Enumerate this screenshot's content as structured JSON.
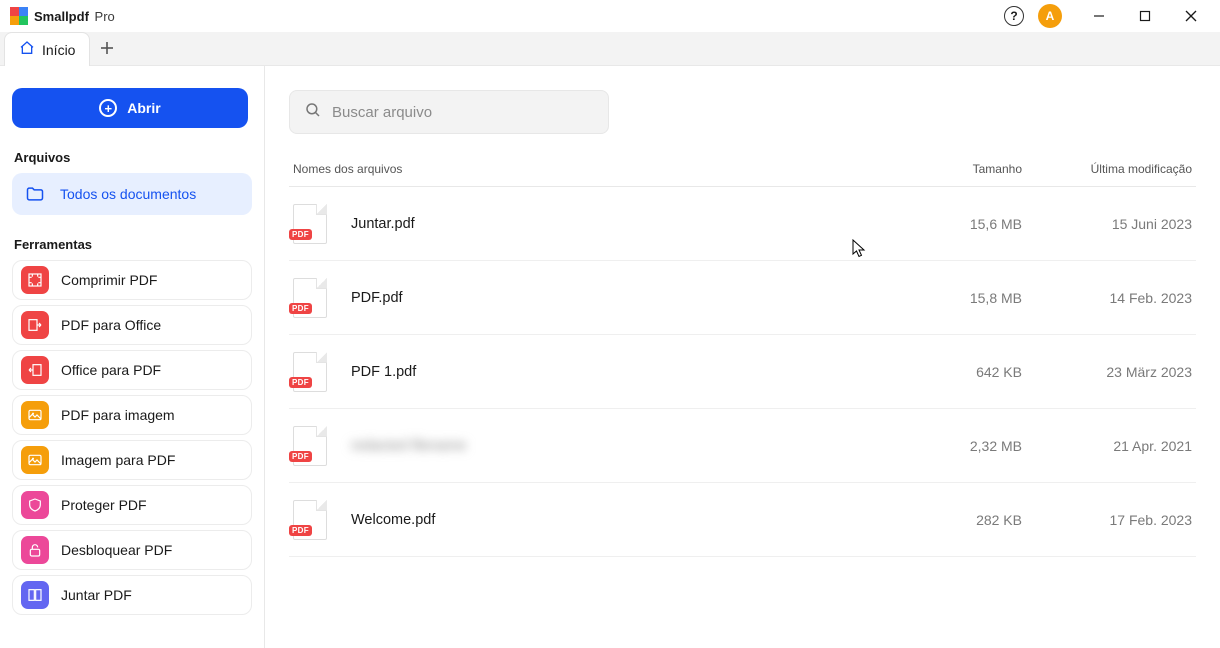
{
  "app": {
    "name": "Smallpdf",
    "tier": "Pro"
  },
  "avatar": {
    "initial": "A"
  },
  "tabs": {
    "home_label": "Início"
  },
  "sidebar": {
    "open_label": "Abrir",
    "section_files": "Arquivos",
    "all_docs": "Todos os documentos",
    "section_tools": "Ferramentas",
    "tools": [
      {
        "label": "Comprimir PDF",
        "color": "red",
        "icon": "compress"
      },
      {
        "label": "PDF para Office",
        "color": "red",
        "icon": "to-office"
      },
      {
        "label": "Office para PDF",
        "color": "red",
        "icon": "from-office"
      },
      {
        "label": "PDF para imagem",
        "color": "amber",
        "icon": "to-image"
      },
      {
        "label": "Imagem para PDF",
        "color": "amber",
        "icon": "from-image"
      },
      {
        "label": "Proteger PDF",
        "color": "pink",
        "icon": "protect"
      },
      {
        "label": "Desbloquear PDF",
        "color": "pink",
        "icon": "unlock"
      },
      {
        "label": "Juntar PDF",
        "color": "ind",
        "icon": "merge"
      }
    ]
  },
  "search": {
    "placeholder": "Buscar arquivo"
  },
  "columns": {
    "name": "Nomes dos arquivos",
    "size": "Tamanho",
    "modified": "Última modificação"
  },
  "files": [
    {
      "name": "Juntar.pdf",
      "size": "15,6 MB",
      "modified": "15 Juni 2023",
      "blurred": false
    },
    {
      "name": "PDF.pdf",
      "size": "15,8 MB",
      "modified": "14 Feb. 2023",
      "blurred": false
    },
    {
      "name": "PDF 1.pdf",
      "size": "642 KB",
      "modified": "23 März 2023",
      "blurred": false
    },
    {
      "name": "redacted filename",
      "size": "2,32 MB",
      "modified": "21 Apr. 2021",
      "blurred": true
    },
    {
      "name": "Welcome.pdf",
      "size": "282 KB",
      "modified": "17 Feb. 2023",
      "blurred": false
    }
  ],
  "icons": {
    "pdf_badge": "PDF"
  }
}
